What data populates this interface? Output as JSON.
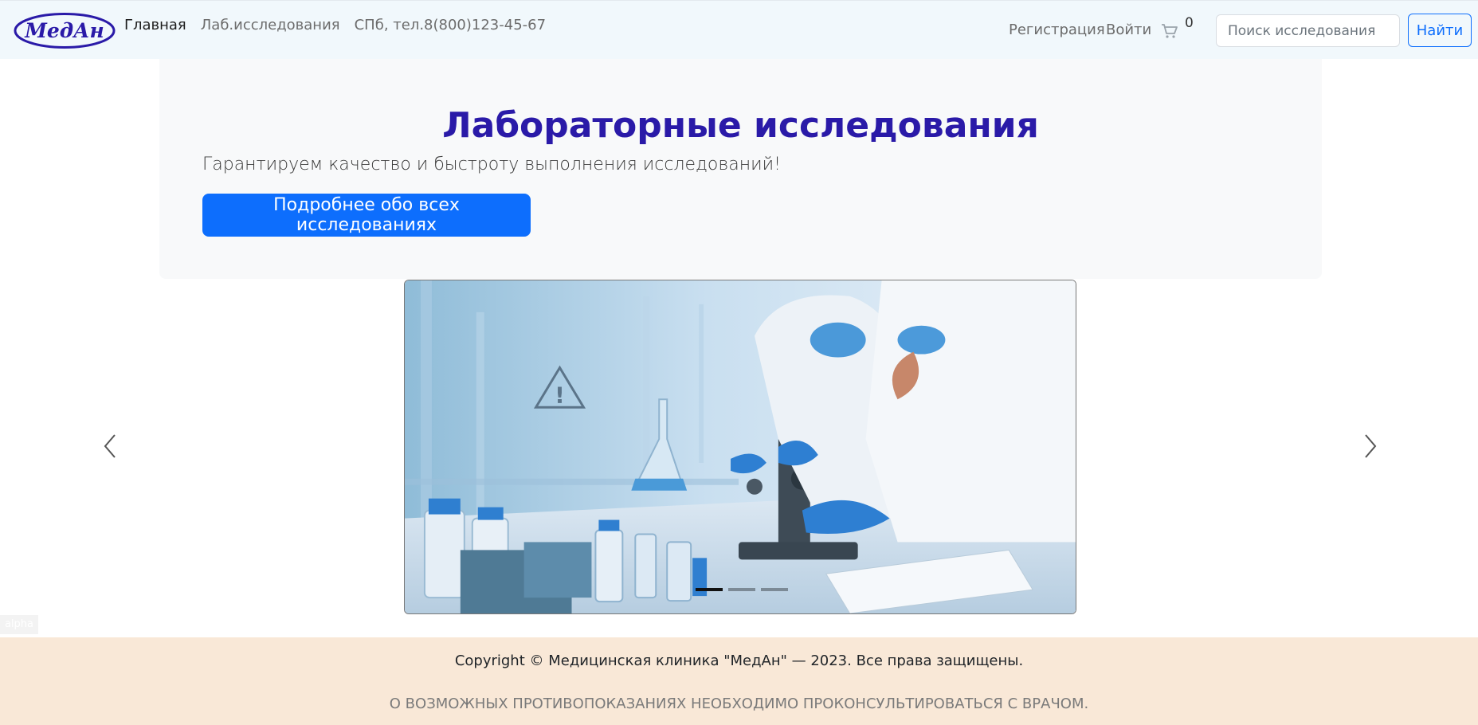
{
  "header": {
    "logo_text": "МедАн",
    "nav": [
      {
        "label": "Главная"
      },
      {
        "label": "Лаб.исследования"
      },
      {
        "label": "СПб, тел.8(800)123-45-67"
      }
    ],
    "register": "Регистрация",
    "login": "Войти",
    "cart_count": "0",
    "search_placeholder": "Поиск исследования",
    "search_button": "Найти"
  },
  "hero": {
    "title": "Лабораторные исследования",
    "subtitle": "Гарантируем качество и быстроту выполнения исследований!",
    "button": "Подробнее обо всех исследованиях"
  },
  "carousel": {
    "slide_count": 3,
    "active_index": 0
  },
  "alpha_label": "alpha",
  "footer": {
    "copyright": "Copyright © Медицинская клиника \"МедАн\" — 2023. Все права защищены.",
    "warning": "О ВОЗМОЖНЫХ ПРОТИВОПОКАЗАНИЯХ НЕОБХОДИМО ПРОКОНСУЛЬТИРОВАТЬСЯ С ВРАЧОМ."
  },
  "colors": {
    "navbar_bg": "#f1f8fc",
    "primary": "#0d6efd",
    "title": "#2a1aa8",
    "footer_bg": "#f9e8d7",
    "logo_blue": "#2a1aa8"
  }
}
